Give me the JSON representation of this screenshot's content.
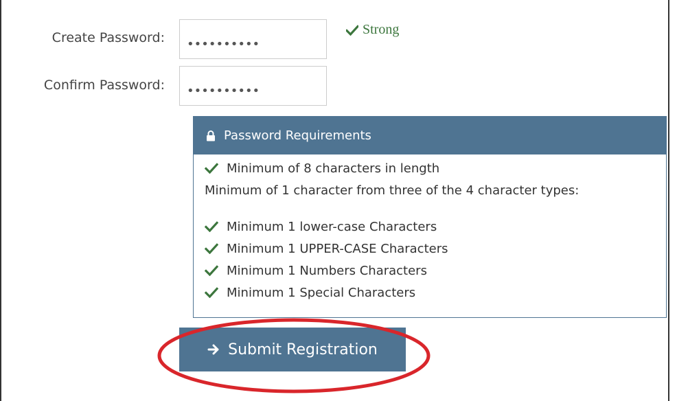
{
  "form": {
    "create_password_label": "Create Password:",
    "create_password_value": "••••••••••",
    "confirm_password_label": "Confirm Password:",
    "confirm_password_value": "••••••••••",
    "strength_text": "Strong"
  },
  "requirements": {
    "title": "Password Requirements",
    "length_rule": "Minimum of 8 characters in length",
    "types_intro": "Minimum of 1 character from three of the 4 character types:",
    "items": [
      "Minimum 1 lower-case Characters",
      "Minimum 1 UPPER-CASE Characters",
      "Minimum 1 Numbers Characters",
      "Minimum 1 Special Characters"
    ]
  },
  "submit": {
    "label": "Submit Registration"
  },
  "colors": {
    "accent": "#4f7492",
    "success": "#3c763d",
    "highlight": "#d9262b"
  },
  "icons": {
    "check": "check-icon",
    "lock": "lock-icon",
    "arrow": "arrow-right-icon"
  }
}
